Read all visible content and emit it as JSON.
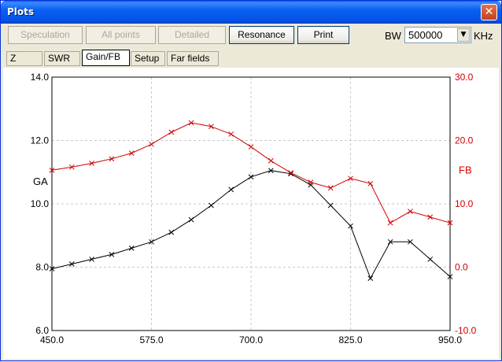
{
  "window": {
    "title": "Plots"
  },
  "toolbar": {
    "speculation": "Speculation",
    "all_points": "All points",
    "detailed": "Detailed",
    "resonance": "Resonance",
    "print": "Print",
    "bw_label": "BW",
    "bw_value": "500000",
    "bw_unit": "KHz"
  },
  "tabs": [
    "Z",
    "SWR",
    "Gain/FB",
    "Setup",
    "Far fields"
  ],
  "icons": {
    "close": "close-icon",
    "dropdown": "chevron-down-icon"
  },
  "colors": {
    "gain": "#000000",
    "fb": "#D00000",
    "grid": "#C8C8C8"
  },
  "chart_data": {
    "type": "line",
    "x": [
      450,
      475,
      500,
      525,
      550,
      575,
      600,
      625,
      650,
      675,
      700,
      725,
      750,
      775,
      800,
      825,
      850,
      875,
      900,
      925,
      950
    ],
    "xlim": [
      450,
      950
    ],
    "x_ticks": [
      "450.0",
      "575.0",
      "700.0",
      "825.0",
      "950.0"
    ],
    "ylabel": "GA",
    "ylim": [
      6,
      14
    ],
    "y_ticks": [
      "14.0",
      "12.0",
      "10.0",
      "8.0",
      "6.0"
    ],
    "y2label": "FB",
    "y2lim": [
      -10,
      30
    ],
    "y2_ticks": [
      "30.0",
      "20.0",
      "10.0",
      "0.0",
      "-10.0"
    ],
    "grid": true,
    "series": [
      {
        "axis": "left",
        "values": [
          7.95,
          8.1,
          8.25,
          8.4,
          8.6,
          8.8,
          9.1,
          9.5,
          9.95,
          10.45,
          10.85,
          11.05,
          10.95,
          10.6,
          9.95,
          9.3,
          7.65,
          8.8,
          8.8,
          8.25,
          7.7
        ]
      },
      {
        "axis": "right",
        "values": [
          15.3,
          15.8,
          16.4,
          17.1,
          18.0,
          19.4,
          21.3,
          22.8,
          22.2,
          21.0,
          19.0,
          16.8,
          14.9,
          13.4,
          12.5,
          14.0,
          13.2,
          7.0,
          8.8,
          7.9,
          7.0
        ]
      }
    ]
  }
}
